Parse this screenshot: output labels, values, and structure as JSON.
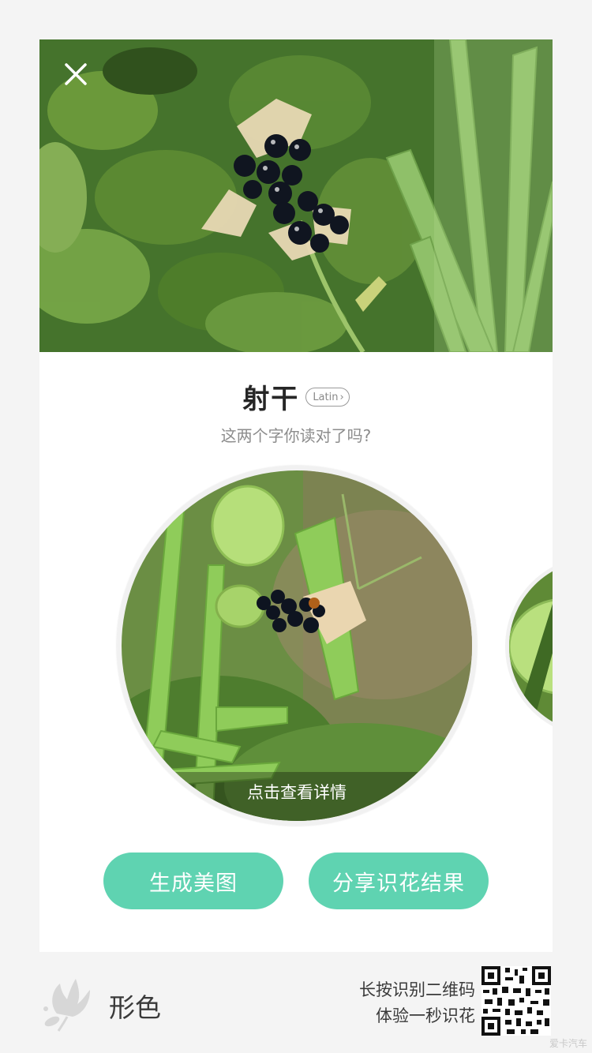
{
  "header": {
    "close_label": "close"
  },
  "plant": {
    "name": "射干",
    "latin_label": "Latin",
    "latin_chevron": "›",
    "pronunciation_hint": "这两个字你读对了吗?"
  },
  "photo": {
    "detail_label": "点击查看详情"
  },
  "actions": {
    "generate_label": "生成美图",
    "share_label": "分享识花结果"
  },
  "footer": {
    "brand_name": "形色",
    "qr_line1": "长按识别二维码",
    "qr_line2": "体验一秒识花",
    "watermark": "爱卡汽车"
  },
  "colors": {
    "accent": "#5fd3b1",
    "background": "#f4f4f4",
    "card": "#ffffff"
  },
  "icons": [
    "close-icon",
    "chevron-right-icon",
    "flower-logo-icon",
    "qr-code-icon"
  ]
}
